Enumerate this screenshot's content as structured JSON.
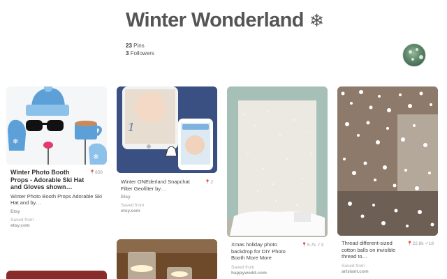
{
  "board": {
    "title": "Winter Wonderland",
    "title_icon": "snowflake-icon",
    "pins_count": "23",
    "pins_label": "Pins",
    "followers_count": "3",
    "followers_label": "Followers"
  },
  "pins": [
    {
      "title": "Winter Photo Booth Props - Adorable Ski Hat and Gloves shown…",
      "desc": "Winter Photo Booth Props Adorable Ski Hat and by…",
      "repins": "858",
      "likes": "",
      "source": "Etsy",
      "saved_label": "Saved from",
      "saved_domain": "etsy.com"
    },
    {
      "title": "",
      "desc": "Winter ONEderland Snapchat Filter Geofilter by…",
      "repins": "2",
      "likes": "",
      "source": "Etsy",
      "saved_label": "Saved from",
      "saved_domain": "etsy.com",
      "image_text": "1"
    },
    {
      "title": "",
      "desc": "Xmas holiday photo backdrop for DIY Photo Booth More More",
      "repins": "5.7k",
      "likes": "3",
      "source": "",
      "saved_label": "Saved from",
      "saved_domain": "happywedd.com"
    },
    {
      "title": "",
      "desc": "Thread different-sized cotton balls on invisible thread to…",
      "repins": "22.8k",
      "likes": "18",
      "source": "",
      "saved_label": "Saved from",
      "saved_domain": "artslant.com"
    }
  ],
  "colors": {
    "title": "#555555",
    "text": "#333333",
    "muted": "#999999"
  }
}
